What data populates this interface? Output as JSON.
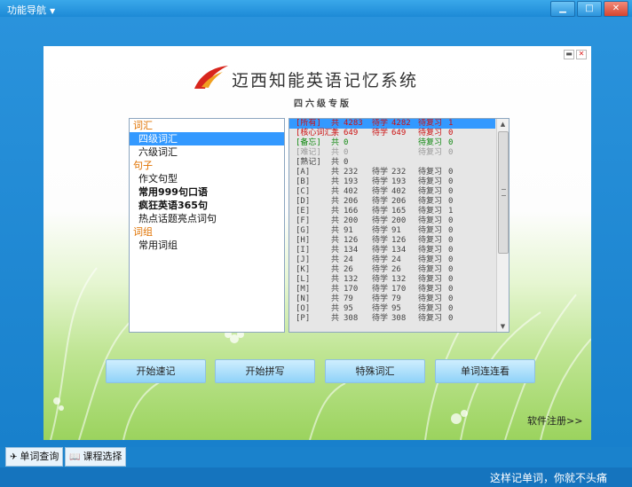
{
  "window": {
    "menu_label": "功能导航",
    "controls": {
      "minimize": "▁",
      "restore": "□",
      "close": "✕"
    }
  },
  "panel": {
    "title": "迈西知能英语记忆系统",
    "edition": "四六级专版",
    "controls": {
      "minimize": "▬",
      "close": "✕"
    }
  },
  "categories": [
    {
      "label": "词汇",
      "items": [
        {
          "label": "四级词汇",
          "selected": true,
          "bold": false
        },
        {
          "label": "六级词汇",
          "selected": false,
          "bold": false
        }
      ]
    },
    {
      "label": "句子",
      "items": [
        {
          "label": "作文句型",
          "selected": false,
          "bold": false
        },
        {
          "label": "常用999句口语",
          "selected": false,
          "bold": true
        },
        {
          "label": "疯狂英语365句",
          "selected": false,
          "bold": true
        },
        {
          "label": "热点话题亮点词句",
          "selected": false,
          "bold": false
        }
      ]
    },
    {
      "label": "词组",
      "items": [
        {
          "label": "常用词组",
          "selected": false,
          "bold": false
        }
      ]
    }
  ],
  "word_groups": [
    {
      "name": "[所有]",
      "total_label": "共",
      "total": "4283",
      "learn_label": "待学",
      "learn": "4282",
      "review_label": "待复习",
      "review": "1",
      "color": "#cc1111",
      "selected": true
    },
    {
      "name": "[核心词汇]",
      "total_label": "共",
      "total": "649",
      "learn_label": "待学",
      "learn": "649",
      "review_label": "待复习",
      "review": "0",
      "color": "#cc1111",
      "selected": false
    },
    {
      "name": "[备忘]",
      "total_label": "共",
      "total": "0",
      "learn_label": "",
      "learn": "",
      "review_label": "待复习",
      "review": "0",
      "color": "#118811",
      "selected": false
    },
    {
      "name": "[难记]",
      "total_label": "共",
      "total": "0",
      "learn_label": "",
      "learn": "",
      "review_label": "待复习",
      "review": "0",
      "color": "#999999",
      "selected": false
    },
    {
      "name": "[熟记]",
      "total_label": "共",
      "total": "0",
      "learn_label": "",
      "learn": "",
      "review_label": "",
      "review": "",
      "color": "#444444",
      "selected": false
    },
    {
      "name": "[A]",
      "total_label": "共",
      "total": "232",
      "learn_label": "待学",
      "learn": "232",
      "review_label": "待复习",
      "review": "0",
      "color": "#444444",
      "selected": false
    },
    {
      "name": "[B]",
      "total_label": "共",
      "total": "193",
      "learn_label": "待学",
      "learn": "193",
      "review_label": "待复习",
      "review": "0",
      "color": "#444444",
      "selected": false
    },
    {
      "name": "[C]",
      "total_label": "共",
      "total": "402",
      "learn_label": "待学",
      "learn": "402",
      "review_label": "待复习",
      "review": "0",
      "color": "#444444",
      "selected": false
    },
    {
      "name": "[D]",
      "total_label": "共",
      "total": "206",
      "learn_label": "待学",
      "learn": "206",
      "review_label": "待复习",
      "review": "0",
      "color": "#444444",
      "selected": false
    },
    {
      "name": "[E]",
      "total_label": "共",
      "total": "166",
      "learn_label": "待学",
      "learn": "165",
      "review_label": "待复习",
      "review": "1",
      "color": "#444444",
      "selected": false
    },
    {
      "name": "[F]",
      "total_label": "共",
      "total": "200",
      "learn_label": "待学",
      "learn": "200",
      "review_label": "待复习",
      "review": "0",
      "color": "#444444",
      "selected": false
    },
    {
      "name": "[G]",
      "total_label": "共",
      "total": "91",
      "learn_label": "待学",
      "learn": "91",
      "review_label": "待复习",
      "review": "0",
      "color": "#444444",
      "selected": false
    },
    {
      "name": "[H]",
      "total_label": "共",
      "total": "126",
      "learn_label": "待学",
      "learn": "126",
      "review_label": "待复习",
      "review": "0",
      "color": "#444444",
      "selected": false
    },
    {
      "name": "[I]",
      "total_label": "共",
      "total": "134",
      "learn_label": "待学",
      "learn": "134",
      "review_label": "待复习",
      "review": "0",
      "color": "#444444",
      "selected": false
    },
    {
      "name": "[J]",
      "total_label": "共",
      "total": "24",
      "learn_label": "待学",
      "learn": "24",
      "review_label": "待复习",
      "review": "0",
      "color": "#444444",
      "selected": false
    },
    {
      "name": "[K]",
      "total_label": "共",
      "total": "26",
      "learn_label": "待学",
      "learn": "26",
      "review_label": "待复习",
      "review": "0",
      "color": "#444444",
      "selected": false
    },
    {
      "name": "[L]",
      "total_label": "共",
      "total": "132",
      "learn_label": "待学",
      "learn": "132",
      "review_label": "待复习",
      "review": "0",
      "color": "#444444",
      "selected": false
    },
    {
      "name": "[M]",
      "total_label": "共",
      "total": "170",
      "learn_label": "待学",
      "learn": "170",
      "review_label": "待复习",
      "review": "0",
      "color": "#444444",
      "selected": false
    },
    {
      "name": "[N]",
      "total_label": "共",
      "total": "79",
      "learn_label": "待学",
      "learn": "79",
      "review_label": "待复习",
      "review": "0",
      "color": "#444444",
      "selected": false
    },
    {
      "name": "[O]",
      "total_label": "共",
      "total": "95",
      "learn_label": "待学",
      "learn": "95",
      "review_label": "待复习",
      "review": "0",
      "color": "#444444",
      "selected": false
    },
    {
      "name": "[P]",
      "total_label": "共",
      "total": "308",
      "learn_label": "待学",
      "learn": "308",
      "review_label": "待复习",
      "review": "0",
      "color": "#444444",
      "selected": false
    }
  ],
  "actions": {
    "start_memorize": "开始速记",
    "start_spelling": "开始拼写",
    "special_vocab": "特殊词汇",
    "word_link": "单词连连看"
  },
  "register_link": "软件注册>>",
  "tabs": {
    "word_lookup": "单词查询",
    "course_select": "课程选择"
  },
  "slogan": "这样记单词，你就不头痛",
  "colors": {
    "selection": "#3399ff",
    "category": "#e07200",
    "accent_red": "#cc1111",
    "accent_green": "#118811"
  }
}
